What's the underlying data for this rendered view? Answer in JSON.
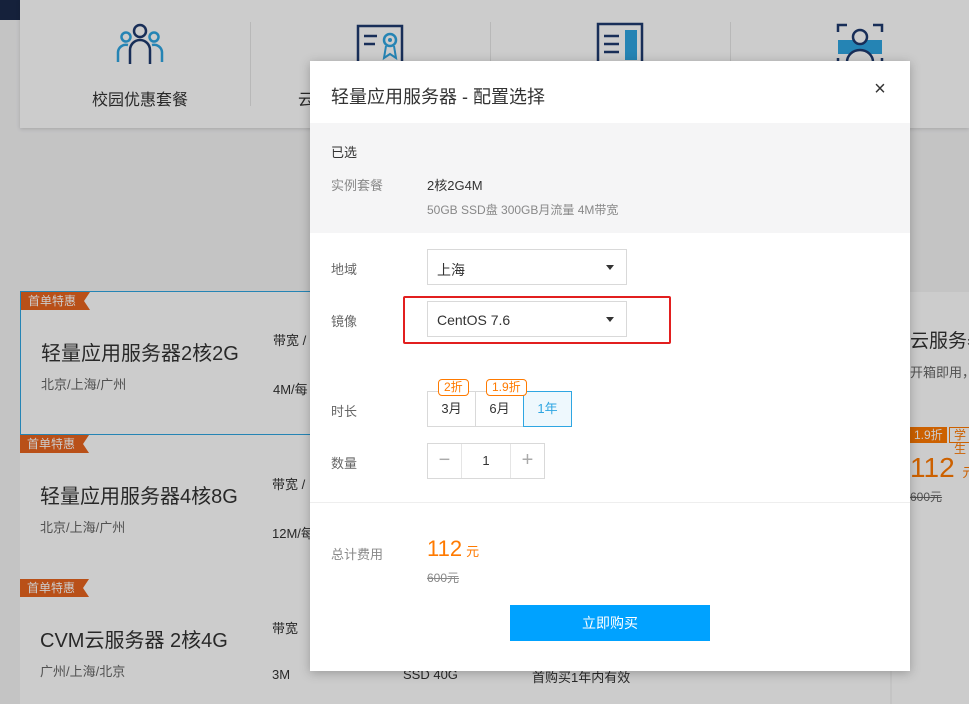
{
  "background": {
    "categories": [
      {
        "label": "校园优惠套餐",
        "icon": "people-icon"
      },
      {
        "label": "云",
        "icon": "certificate-icon"
      },
      {
        "label": "",
        "icon": "book-icon"
      },
      {
        "label": "",
        "icon": "user-card-icon"
      }
    ],
    "cards": [
      {
        "badge": "首单特惠",
        "name": "轻量应用服务器2核2G",
        "region": "北京/上海/广州",
        "bw_label": "带宽 /",
        "bw_value": "4M/每"
      },
      {
        "badge": "首单特惠",
        "name": "轻量应用服务器4核8G",
        "region": "北京/上海/广州",
        "bw_label": "带宽 /",
        "bw_value": "12M/每"
      },
      {
        "badge": "首单特惠",
        "name": "CVM云服务器 2核4G",
        "region": "广州/上海/北京",
        "bw_label": "带宽",
        "bw_value": "3M",
        "disk_value": "SSD 40G",
        "note": "首购买1年内有效"
      }
    ],
    "right_card": {
      "title": "云服务器",
      "subtitle": "开箱即用，",
      "discount": "1.9折",
      "student": "学生",
      "price": "112",
      "unit": "元",
      "old_price": "600元"
    }
  },
  "modal": {
    "title": "轻量应用服务器 - 配置选择",
    "close": "×",
    "selected": {
      "heading": "已选",
      "plan_label": "实例套餐",
      "plan_value": "2核2G4M",
      "plan_detail": "50GB SSD盘 300GB月流量 4M带宽"
    },
    "region": {
      "label": "地域",
      "value": "上海"
    },
    "image": {
      "label": "镜像",
      "value": "CentOS 7.6"
    },
    "duration": {
      "label": "时长",
      "options": [
        {
          "label": "3月",
          "tag": "2折"
        },
        {
          "label": "6月",
          "tag": "1.9折"
        },
        {
          "label": "1年",
          "tag": ""
        }
      ],
      "selected": "1年"
    },
    "quantity": {
      "label": "数量",
      "minus": "−",
      "value": "1",
      "plus": "+"
    },
    "total": {
      "label": "总计费用",
      "price": "112",
      "unit": "元",
      "old_price": "600元"
    },
    "buy_label": "立即购买"
  },
  "colors": {
    "accent": "#00a2ff",
    "price": "#ff7a00",
    "badge": "#e8651e",
    "highlight": "#e21f1f"
  }
}
